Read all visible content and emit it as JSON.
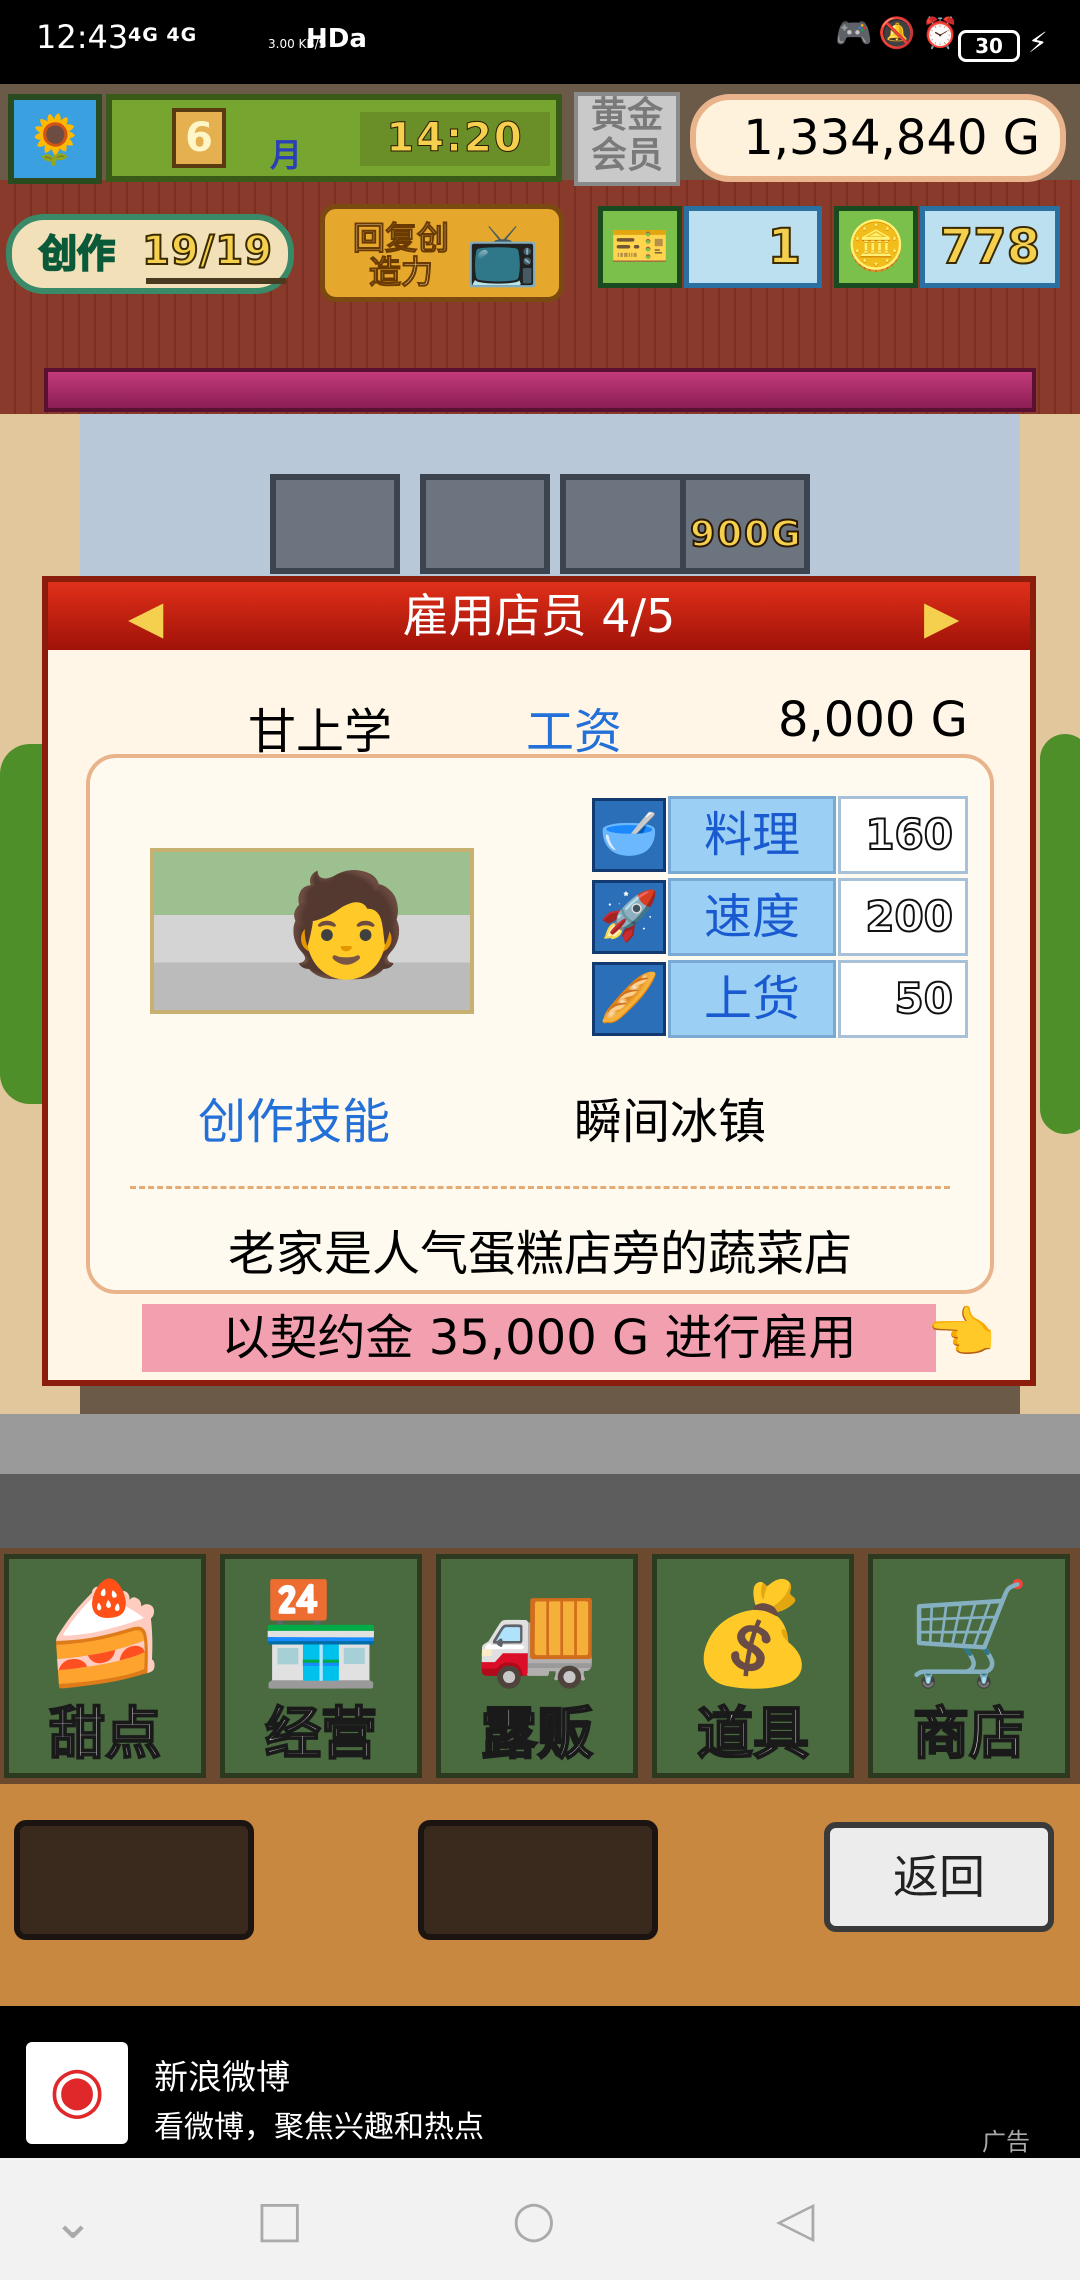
{
  "status_bar": {
    "time": "12:43",
    "network": "4G 4G",
    "speed": "3.00 KB/S",
    "hd": "HDa",
    "icons": "🎮🔕⏰",
    "battery": "30",
    "bolt": "⚡"
  },
  "hud": {
    "month": "6",
    "month_label": "月",
    "time": "14:20",
    "gold_member": "黄金会员",
    "money": "1,334,840 G",
    "create_label": "创作",
    "create_count": "19/19",
    "restore_label": "回复创造力",
    "tickets": "1",
    "medals": "778",
    "scene_price": "900G"
  },
  "dialog": {
    "title": "雇用店员 4/5",
    "name": "甘上学",
    "wage_label": "工资",
    "wage_value": "8,000 G",
    "stats": [
      {
        "label": "料理",
        "value": "160",
        "icon": "🥣"
      },
      {
        "label": "速度",
        "value": "200",
        "icon": "🚀"
      },
      {
        "label": "上货",
        "value": "50",
        "icon": "🥖"
      }
    ],
    "skill_label": "创作技能",
    "skill_value": "瞬间冰镇",
    "description": "老家是人气蛋糕店旁的蔬菜店",
    "hire_button": "以契约金 35,000 G 进行雇用"
  },
  "menu": [
    {
      "label": "甜点",
      "icon": "🍰"
    },
    {
      "label": "经营",
      "icon": "🏪"
    },
    {
      "label": "露贩",
      "icon": "🚚"
    },
    {
      "label": "道具",
      "icon": "💰"
    },
    {
      "label": "商店",
      "icon": "🛒"
    }
  ],
  "back_button": "返回",
  "ad": {
    "title": "新浪微博",
    "subtitle": "看微博，聚焦兴趣和热点",
    "tag": "广告"
  }
}
